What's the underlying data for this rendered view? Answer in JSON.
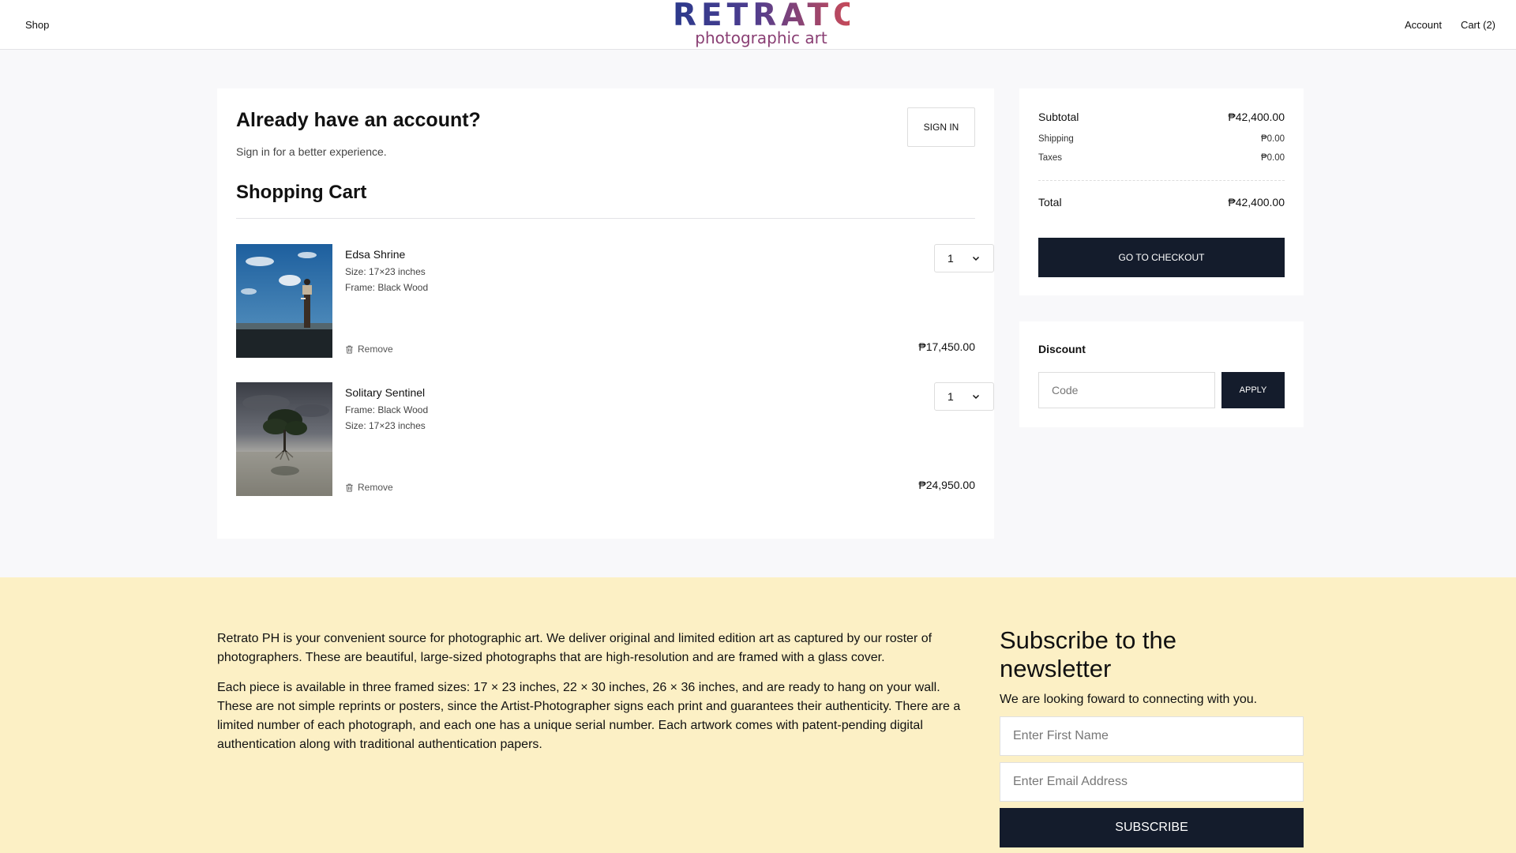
{
  "header": {
    "nav_shop": "Shop",
    "logo_main": "RETRATO",
    "logo_sub": "photographic art",
    "nav_account": "Account",
    "nav_cart": "Cart (2)"
  },
  "account": {
    "title": "Already have an account?",
    "subtitle": "Sign in for a better experience.",
    "sign_in_label": "SIGN IN"
  },
  "cart": {
    "title": "Shopping Cart",
    "items": [
      {
        "name": "Edsa Shrine",
        "attr1": "Size: 17×23 inches",
        "attr2": "Frame: Black Wood",
        "quantity": "1",
        "price": "₱17,450.00",
        "remove_label": "Remove",
        "image": "edsa-shrine-photo"
      },
      {
        "name": "Solitary Sentinel",
        "attr1": "Frame: Black Wood",
        "attr2": "Size: 17×23 inches",
        "quantity": "1",
        "price": "₱24,950.00",
        "remove_label": "Remove",
        "image": "solitary-sentinel-photo"
      }
    ]
  },
  "summary": {
    "subtotal_label": "Subtotal",
    "subtotal_value": "₱42,400.00",
    "shipping_label": "Shipping",
    "shipping_value": "₱0.00",
    "taxes_label": "Taxes",
    "taxes_value": "₱0.00",
    "total_label": "Total",
    "total_value": "₱42,400.00",
    "checkout_label": "GO TO CHECKOUT"
  },
  "discount": {
    "title": "Discount",
    "placeholder": "Code",
    "apply_label": "APPLY"
  },
  "footer": {
    "about_p1": "Retrato PH is your convenient source for photographic art. We deliver original and limited edition art as captured by our roster of photographers. These are beautiful, large-sized photographs that are high-resolution and are framed with a glass cover.",
    "about_p2": "Each piece is available in three framed sizes: 17 × 23 inches, 22 × 30 inches, 26 × 36 inches, and are ready to hang on your wall. These are not simple reprints or posters, since the Artist-Photographer signs each print and guarantees their authenticity. There are a limited number of each photograph, and each one has a unique serial number. Each artwork comes with patent-pending digital authentication along with traditional authentication papers.",
    "newsletter_title": "Subscribe to the newsletter",
    "newsletter_sub": "We are looking foward to connecting with you.",
    "first_name_placeholder": "Enter First Name",
    "email_placeholder": "Enter Email Address",
    "subscribe_label": "SUBSCRIBE"
  },
  "colors": {
    "primary_button": "#141c2c",
    "footer_bg": "#fcf0c5",
    "page_bg": "#f8f8fa"
  }
}
